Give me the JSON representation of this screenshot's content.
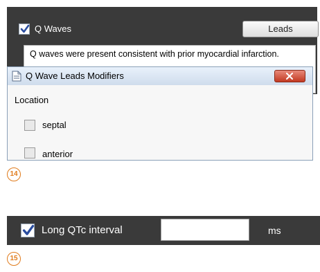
{
  "q_waves": {
    "checkbox_checked": true,
    "label": "Q Waves",
    "leads_button": "Leads",
    "comment": "Q waves were present consistent with prior myocardial infarction."
  },
  "dialog": {
    "title": "Q Wave Leads Modifiers",
    "section_label": "Location",
    "options": [
      {
        "label": "septal",
        "checked": false
      },
      {
        "label": "anterior",
        "checked": false
      }
    ]
  },
  "callouts": {
    "first": "14",
    "second": "15"
  },
  "long_qtc": {
    "checkbox_checked": true,
    "label": "Long QTc interval",
    "value": "",
    "unit": "ms"
  },
  "colors": {
    "panel_bg": "#3a3a3a",
    "check_blue": "#2a4da0",
    "callout_orange": "#e07b1c"
  }
}
